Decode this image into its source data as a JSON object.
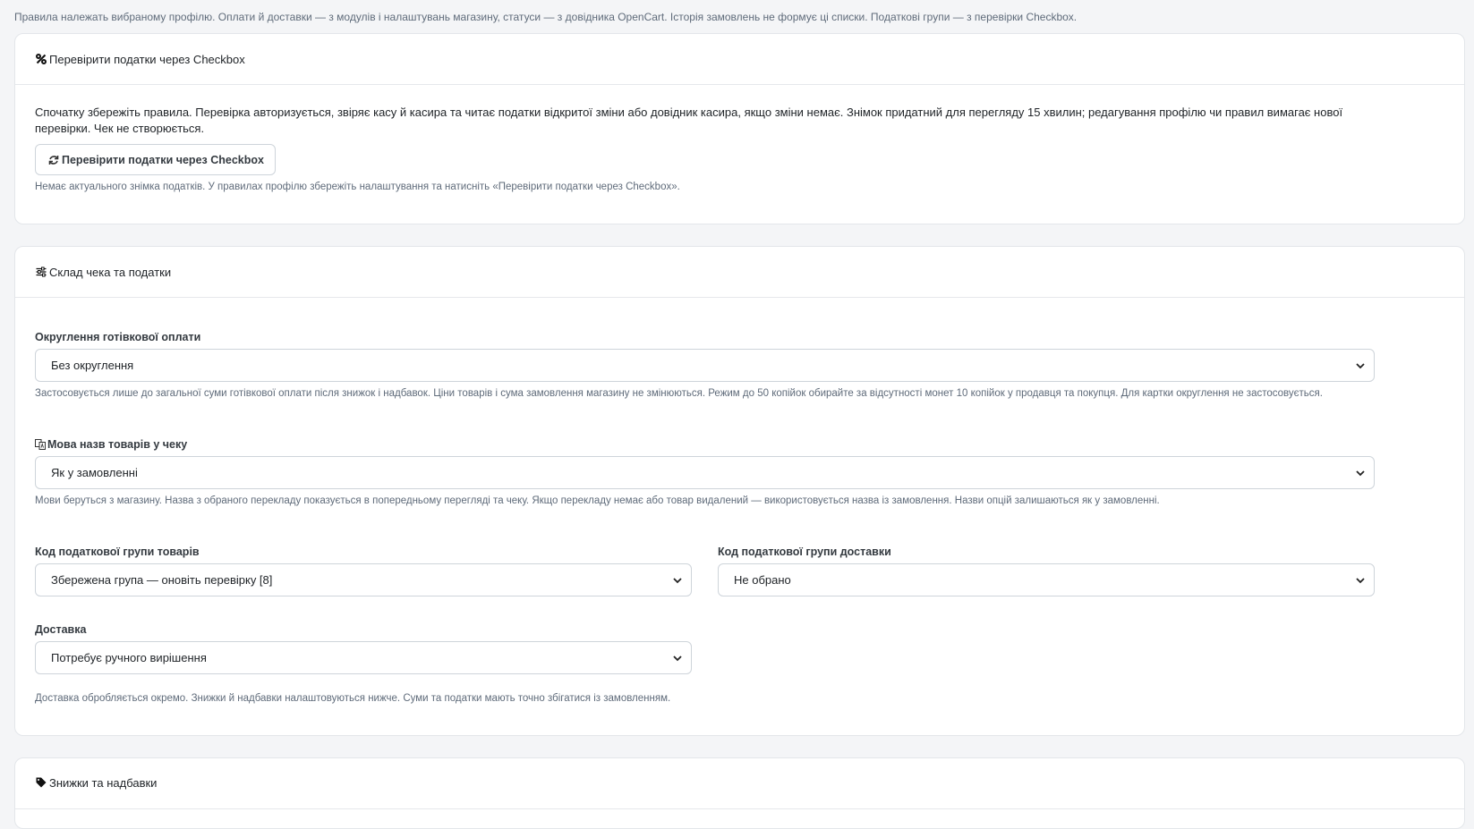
{
  "intro_text": "Правила належать вибраному профілю. Оплати й доставки — з модулів і налаштувань магазину, статуси — з довідника OpenCart. Історія замовлень не формує ці списки. Податкові групи — з перевірки Checkbox.",
  "check_card": {
    "title": "Перевірити податки через Checkbox",
    "icon": "percent-icon",
    "description": "Спочатку збережіть правила. Перевірка авторизується, звіряє касу й касира та читає податки відкритої зміни або довідник касира, якщо зміни немає. Знімок придатний для перегляду 15 хвилин; редагування профілю чи правил вимагає нової перевірки. Чек не створюється.",
    "button_label": "Перевірити податки через Checkbox",
    "button_icon": "refresh-icon",
    "status_text": "Немає актуального знімка податків. У правилах профілю збережіть налаштування та натисніть «Перевірити податки через Checkbox»."
  },
  "receipt_card": {
    "title": "Склад чека та податки",
    "icon": "sliders-icon",
    "rounding": {
      "label": "Округлення готівкової оплати",
      "value": "Без округлення",
      "help": "Застосовується лише до загальної суми готівкової оплати після знижок і надбавок. Ціни товарів і сума замовлення магазину не змінюються. Режим до 50 копійок обирайте за відсутності монет 10 копійок у продавця та покупця. Для картки округлення не застосовується."
    },
    "language": {
      "label": "Мова назв товарів у чеку",
      "icon": "language-icon",
      "value": "Як у замовленні",
      "help": "Мови беруться з магазину. Назва з обраного перекладу показується в попередньому перегляді та чеку. Якщо перекладу немає або товар видалений — використовується назва із замовлення. Назви опцій залишаються як у замовленні."
    },
    "product_tax": {
      "label": "Код податкової групи товарів",
      "value": "Збережена група — оновіть перевірку [8]"
    },
    "shipping_tax": {
      "label": "Код податкової групи доставки",
      "value": "Не обрано"
    },
    "shipping": {
      "label": "Доставка",
      "value": "Потребує ручного вирішення"
    },
    "shipping_help": "Доставка обробляється окремо. Знижки й надбавки налаштовуються нижче. Суми та податки мають точно збігатися із замовленням."
  },
  "discounts_card": {
    "title": "Знижки та надбавки",
    "icon": "tags-icon"
  }
}
